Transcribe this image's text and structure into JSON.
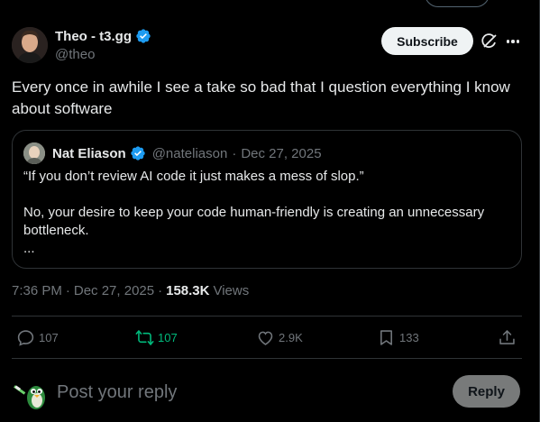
{
  "author": {
    "name": "Theo - t3.gg",
    "handle": "@theo",
    "verified": true
  },
  "header": {
    "subscribe_label": "Subscribe"
  },
  "tweet": {
    "text": "Every once in awhile I see a take so bad that I question everything I know about software"
  },
  "quote": {
    "name": "Nat Eliason",
    "handle": "@nateliason",
    "separator": "·",
    "date": "Dec 27, 2025",
    "line1": "“If you don’t review AI code it just makes a mess of slop.”",
    "line2": "No, your desire to keep your code human-friendly is creating an unnecessary bottleneck.",
    "ellipsis": "..."
  },
  "meta": {
    "time": "7:36 PM",
    "dot": "·",
    "date": "Dec 27, 2025",
    "views_count": "158.3K",
    "views_label": "Views"
  },
  "actions": {
    "replies": "107",
    "reposts": "107",
    "likes": "2.9K",
    "bookmarks": "133"
  },
  "reply": {
    "placeholder": "Post your reply",
    "button_label": "Reply"
  },
  "colors": {
    "background": "#000000",
    "text": "#e7e9ea",
    "muted": "#71767b",
    "verified": "#1d9bf0",
    "repost_active": "#00ba7c",
    "border": "#2f3336"
  },
  "icons": [
    "verified-badge-icon",
    "grok-icon",
    "more-icon",
    "reply-icon",
    "repost-icon",
    "like-icon",
    "bookmark-icon",
    "share-icon"
  ]
}
